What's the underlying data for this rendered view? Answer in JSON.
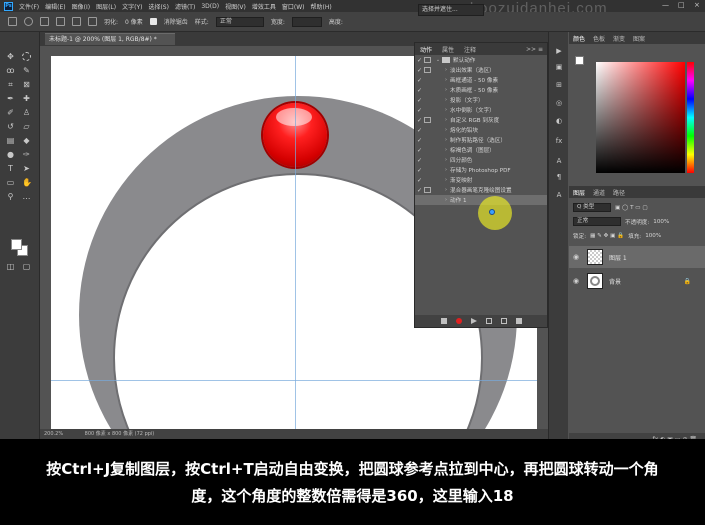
{
  "app": {
    "logo": "Ps",
    "menu": [
      "文件(F)",
      "编辑(E)",
      "图像(I)",
      "图层(L)",
      "文字(Y)",
      "选择(S)",
      "滤镜(T)",
      "3D(D)",
      "视图(V)",
      "增效工具",
      "窗口(W)",
      "帮助(H)"
    ],
    "watermark": "www.hoozuidanhei.com",
    "window_controls": [
      "—",
      "□",
      "×"
    ]
  },
  "options_bar": {
    "feather_label": "羽化:",
    "feather_value": "0 像素",
    "antialias_label": "消除锯齿",
    "style_label": "样式:",
    "style_value": "正常",
    "width_label": "宽度:",
    "height_label": "高度:",
    "select_mask_button": "选择并遮住...",
    "search_text": "选择并遮住..."
  },
  "document": {
    "tab_title": "未标题-1 @ 200% (图层 1, RGB/8#) *",
    "zoom": "200.2%",
    "status": "800 像素 x 800 像素 (72 ppi)"
  },
  "actions_panel": {
    "tabs": [
      "动作",
      "属性",
      "注释"
    ],
    "collapse": ">> ≡",
    "rows": [
      {
        "check": "✓",
        "box": true,
        "tri": "⌄",
        "label": "默认动作",
        "folder": true
      },
      {
        "check": "✓",
        "box": true,
        "tri": "›",
        "label": "淡出效果（选区）"
      },
      {
        "check": "✓",
        "box": false,
        "tri": "›",
        "label": "画框通道 - 50 像素"
      },
      {
        "check": "✓",
        "box": false,
        "tri": "›",
        "label": "木质画框 - 50 像素"
      },
      {
        "check": "✓",
        "box": false,
        "tri": "›",
        "label": "投影（文字）"
      },
      {
        "check": "✓",
        "box": false,
        "tri": "›",
        "label": "水中倒影（文字）"
      },
      {
        "check": "✓",
        "box": true,
        "tri": "›",
        "label": "自定义 RGB 到灰度"
      },
      {
        "check": "✓",
        "box": false,
        "tri": "›",
        "label": "熔化的铅块"
      },
      {
        "check": "✓",
        "box": false,
        "tri": "›",
        "label": "制作剪贴路径（选区）"
      },
      {
        "check": "✓",
        "box": false,
        "tri": "›",
        "label": "棕褐色调（图层）"
      },
      {
        "check": "✓",
        "box": false,
        "tri": "›",
        "label": "四分颜色"
      },
      {
        "check": "✓",
        "box": false,
        "tri": "›",
        "label": "存储为 Photoshop PDF"
      },
      {
        "check": "✓",
        "box": false,
        "tri": "›",
        "label": "渐变映射"
      },
      {
        "check": "✓",
        "box": true,
        "tri": "›",
        "label": "混合器画笔克隆绘图设置"
      },
      {
        "check": "",
        "box": false,
        "tri": "›",
        "label": "动作 1",
        "selected": true
      }
    ]
  },
  "color_panel": {
    "tabs": [
      "颜色",
      "色板",
      "渐变",
      "图案"
    ]
  },
  "layers_panel": {
    "tabs": [
      "图层",
      "通道",
      "路径"
    ],
    "kind_filter": "Q 类型",
    "blend_mode": "正常",
    "opacity_label": "不透明度:",
    "opacity_value": "100%",
    "lock_label": "锁定:",
    "fill_label": "填充:",
    "fill_value": "100%",
    "layers": [
      {
        "name": "图层 1",
        "selected": true
      },
      {
        "name": "背景",
        "selected": false
      }
    ],
    "footer": "fx ◐ ▣ ▭ ⊕ 🗑"
  },
  "subtitle": {
    "line1": "按Ctrl+J复制图层，按Ctrl+T启动自由变换，把圆球参考点拉到中心，再把圆球转动一个角",
    "line2": "度，这个角度的整数倍需得是360，这里输入18"
  },
  "colors": {
    "ball": "#e00000",
    "ring": "#8a8a8d",
    "highlight": "#e6e628"
  }
}
